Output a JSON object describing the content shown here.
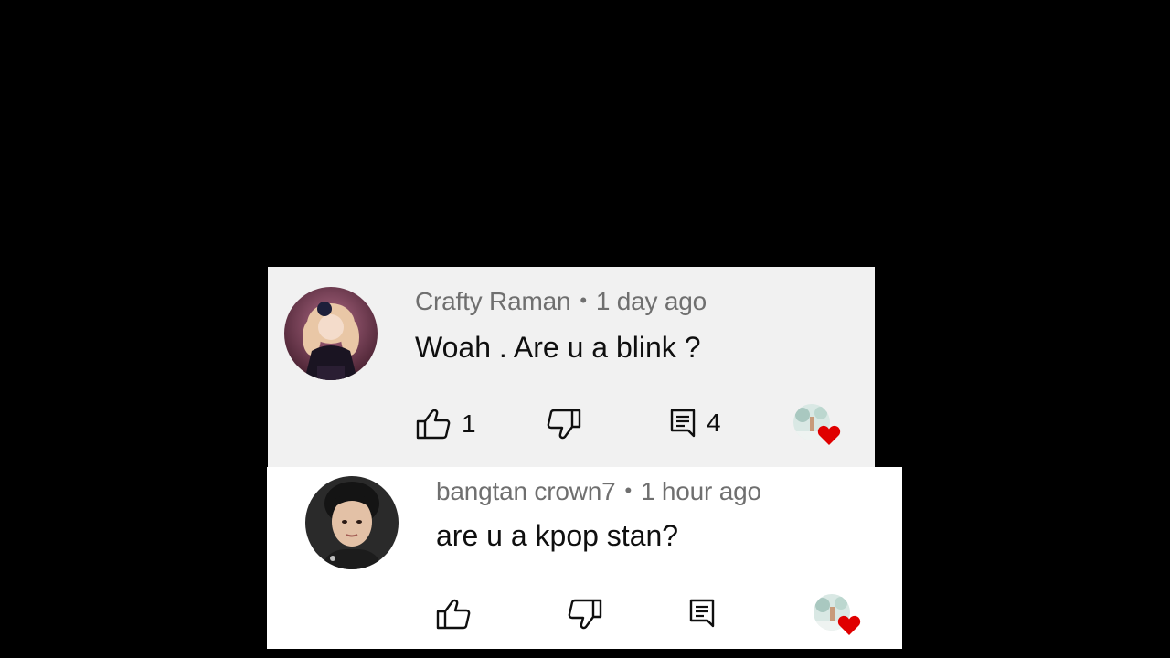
{
  "comments": [
    {
      "author": "Crafty Raman",
      "separator": "•",
      "time": "1 day ago",
      "text": "Woah . Are u a blink ?",
      "likes": "1",
      "replies": "4",
      "background": "#f1f1f1",
      "icons": {
        "avatar": "avatar-doll-girl",
        "like": "thumbs-up-icon",
        "dislike": "thumbs-down-icon",
        "reply": "comment-icon",
        "creator_heart": "heart-icon"
      }
    },
    {
      "author": "bangtan crown7",
      "separator": "•",
      "time": "1 hour ago",
      "text": "are u a kpop stan?",
      "likes": "",
      "replies": "",
      "background": "#ffffff",
      "icons": {
        "avatar": "avatar-man-portrait",
        "like": "thumbs-up-icon",
        "dislike": "thumbs-down-icon",
        "reply": "comment-icon",
        "creator_heart": "heart-icon"
      }
    }
  ],
  "colors": {
    "page_background": "#000000",
    "meta_text": "#6f6f6f",
    "body_text": "#0f0f0f",
    "heart": "#e00000"
  }
}
